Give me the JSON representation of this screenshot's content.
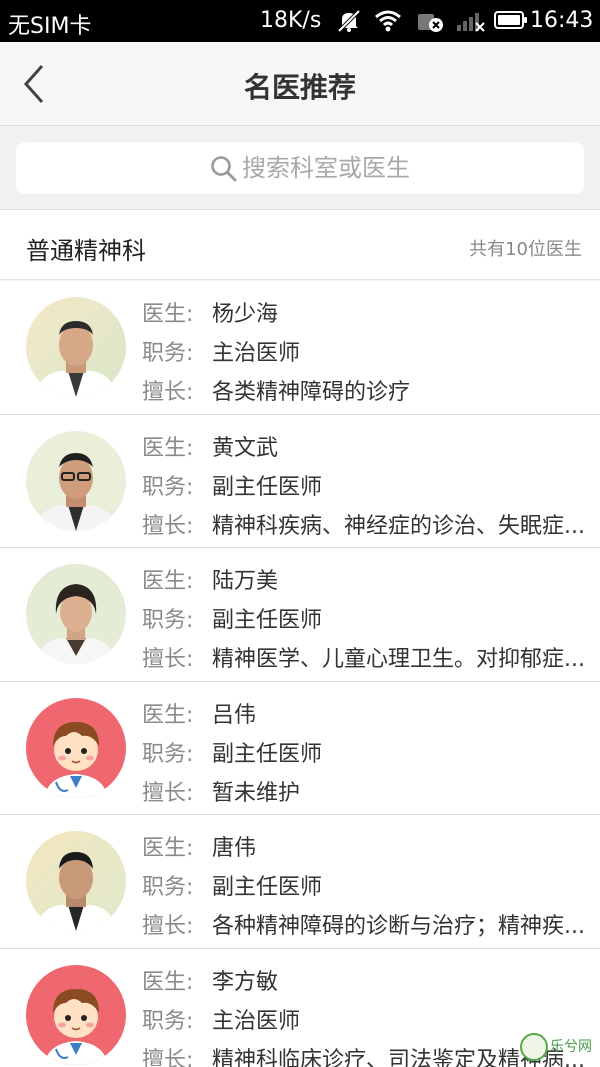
{
  "status_bar": {
    "carrier": "无SIM卡",
    "speed": "18K/s",
    "time": "16:43",
    "icons": [
      "mute-icon",
      "wifi-icon",
      "data-off-icon",
      "signal-icon",
      "battery-icon"
    ]
  },
  "header": {
    "title": "名医推荐",
    "back_icon": "chevron-left-icon"
  },
  "search": {
    "placeholder": "搜索科室或医生",
    "icon": "search-icon"
  },
  "section": {
    "name": "普通精神科",
    "count": "共有10位医生"
  },
  "labels": {
    "doctor": "医生:",
    "title": "职务:",
    "specialty": "擅长:"
  },
  "doctors": [
    {
      "name": "杨少海",
      "title": "主治医师",
      "specialty": "各类精神障碍的诊疗",
      "avatar": "photo"
    },
    {
      "name": "黄文武",
      "title": "副主任医师",
      "specialty": "精神科疾病、神经症的诊治、失眠症...",
      "avatar": "photo"
    },
    {
      "name": "陆万美",
      "title": "副主任医师",
      "specialty": "精神医学、儿童心理卫生。对抑郁症...",
      "avatar": "photo"
    },
    {
      "name": "吕伟",
      "title": "副主任医师",
      "specialty": "暂未维护",
      "avatar": "cartoon"
    },
    {
      "name": "唐伟",
      "title": "副主任医师",
      "specialty": "各种精神障碍的诊断与治疗；精神疾...",
      "avatar": "photo"
    },
    {
      "name": "李方敏",
      "title": "主治医师",
      "specialty": "精神科临床诊疗、司法鉴定及精神病...",
      "avatar": "cartoon"
    }
  ],
  "watermark": "乐兮网",
  "colors": {
    "header_bg": "#f7f7f7",
    "page_bg": "#f2f2f2",
    "label": "#8a8a8a",
    "value": "#333333",
    "cartoon_bg": "#f0686f"
  }
}
